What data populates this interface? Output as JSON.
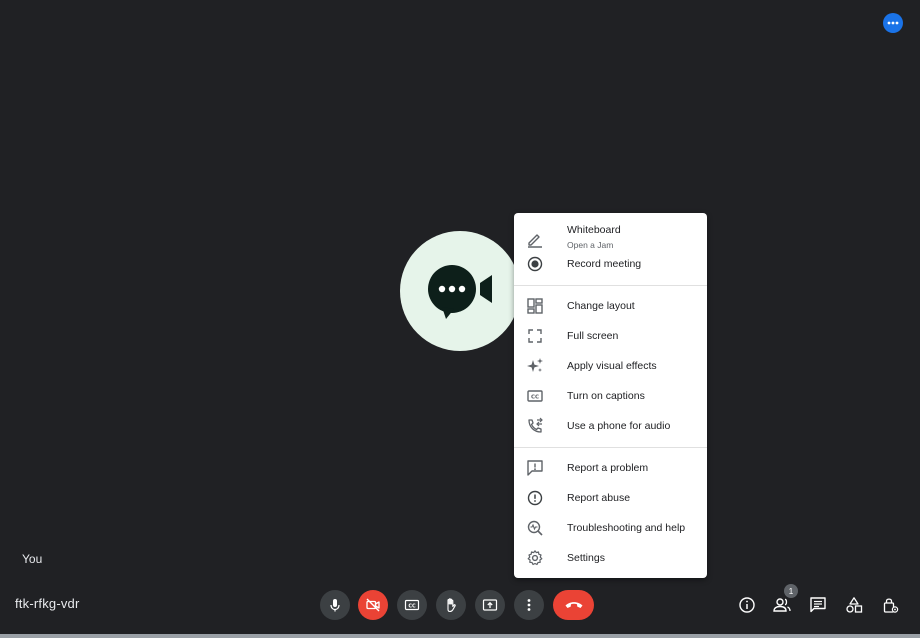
{
  "self_tile": {
    "name": "You"
  },
  "meeting": {
    "code": "ftk-rfkg-vdr"
  },
  "participants": {
    "count": "1"
  },
  "colors": {
    "background": "#202124",
    "avatar_bg": "#e6f4ea",
    "accent_blue": "#1a73e8",
    "danger_red": "#ea4335",
    "control_gray": "#3c4043"
  },
  "menu": {
    "items": [
      {
        "label": "Whiteboard",
        "sublabel": "Open a Jam",
        "icon": "pencil-icon"
      },
      {
        "label": "Record meeting",
        "icon": "record-icon"
      },
      {
        "label": "Change layout",
        "icon": "layout-icon"
      },
      {
        "label": "Full screen",
        "icon": "fullscreen-icon"
      },
      {
        "label": "Apply visual effects",
        "icon": "sparkle-icon"
      },
      {
        "label": "Turn on captions",
        "icon": "captions-icon"
      },
      {
        "label": "Use a phone for audio",
        "icon": "phone-icon"
      },
      {
        "label": "Report a problem",
        "icon": "feedback-icon"
      },
      {
        "label": "Report abuse",
        "icon": "alert-icon"
      },
      {
        "label": "Troubleshooting and help",
        "icon": "troubleshoot-icon"
      },
      {
        "label": "Settings",
        "icon": "gear-icon"
      }
    ]
  },
  "controls": {
    "bottom": [
      "microphone-icon",
      "camera-off-icon",
      "captions-icon",
      "hand-raise-icon",
      "present-icon",
      "more-vertical-icon",
      "hang-up-icon"
    ],
    "right": [
      "info-icon",
      "people-icon",
      "chat-icon",
      "activities-icon",
      "host-controls-icon"
    ]
  }
}
